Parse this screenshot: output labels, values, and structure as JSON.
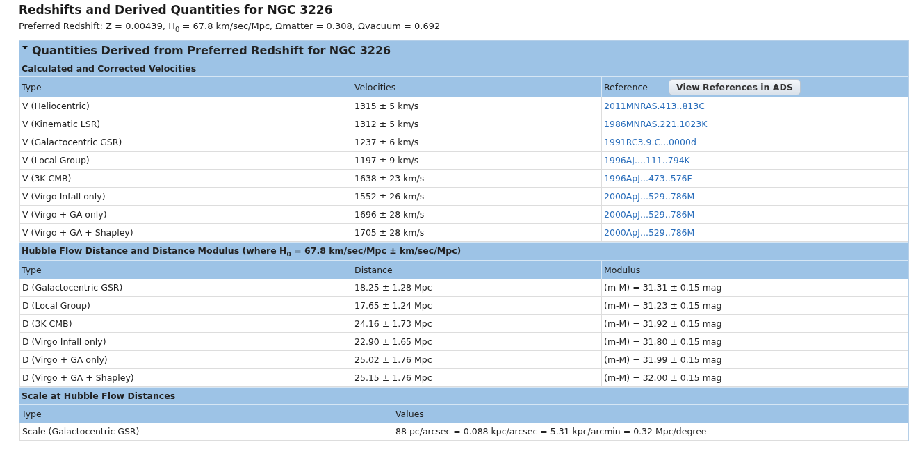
{
  "page_title": "Redshifts and Derived Quantities for NGC 3226",
  "preferred_redshift": "Preferred Redshift: Z = 0.00439, H$_{0}$ = 67.8 km/sec/Mpc, Ωmatter = 0.308, Ωvacuum = 0.692",
  "panel": {
    "title": "Quantities Derived from Preferred Redshift for NGC 3226",
    "expanded": true,
    "sections": [
      {
        "kind": "references",
        "title": "Calculated and Corrected Velocities",
        "columns": [
          "Type",
          "Velocities",
          "Reference"
        ],
        "button": "View References in ADS",
        "rows": [
          {
            "cells": [
              "V (Heliocentric)",
              "1315 ± 5 km/s",
              "2011MNRAS.413..813C"
            ]
          },
          {
            "cells": [
              "V (Kinematic LSR)",
              "1312 ± 5 km/s",
              "1986MNRAS.221.1023K"
            ]
          },
          {
            "cells": [
              "V (Galactocentric GSR)",
              "1237 ± 6 km/s",
              "1991RC3.9.C...0000d"
            ]
          },
          {
            "cells": [
              "V (Local Group)",
              "1197 ± 9 km/s",
              "1996AJ....111..794K"
            ]
          },
          {
            "cells": [
              "V (3K CMB)",
              "1638 ± 23 km/s",
              "1996ApJ...473..576F"
            ]
          },
          {
            "cells": [
              "V (Virgo Infall only)",
              "1552 ± 26 km/s",
              "2000ApJ...529..786M"
            ]
          },
          {
            "cells": [
              "V (Virgo + GA only)",
              "1696 ± 28 km/s",
              "2000ApJ...529..786M"
            ]
          },
          {
            "cells": [
              "V (Virgo + GA + Shapley)",
              "1705 ± 28 km/s",
              "2000ApJ...529..786M"
            ]
          }
        ]
      },
      {
        "kind": "distances",
        "title": "Hubble Flow Distance and Distance Modulus (where H$_{0}$ = 67.8 km/sec/Mpc ± km/sec/Mpc)",
        "columns": [
          "Type",
          "Distance",
          "Modulus"
        ],
        "rows": [
          {
            "cells": [
              "D (Galactocentric GSR)",
              "18.25 ± 1.28 Mpc",
              "(m-M) = 31.31 ± 0.15 mag"
            ]
          },
          {
            "cells": [
              "D (Local Group)",
              "17.65 ± 1.24 Mpc",
              "(m-M) = 31.23 ± 0.15 mag"
            ]
          },
          {
            "cells": [
              "D (3K CMB)",
              "24.16 ± 1.73 Mpc",
              "(m-M) = 31.92 ± 0.15 mag"
            ]
          },
          {
            "cells": [
              "D (Virgo Infall only)",
              "22.90 ± 1.65 Mpc",
              "(m-M) = 31.80 ± 0.15 mag"
            ]
          },
          {
            "cells": [
              "D (Virgo + GA only)",
              "25.02 ± 1.76 Mpc",
              "(m-M) = 31.99 ± 0.15 mag"
            ]
          },
          {
            "cells": [
              "D (Virgo + GA + Shapley)",
              "25.15 ± 1.76 Mpc",
              "(m-M) = 32.00 ± 0.15 mag"
            ]
          }
        ]
      },
      {
        "kind": "scale",
        "title": "Scale at Hubble Flow Distances",
        "columns": [
          "Type",
          "Values"
        ],
        "rows": [
          {
            "cells": [
              "Scale (Galactocentric GSR)",
              "88 pc/arcsec = 0.088 kpc/arcsec = 5.31 kpc/arcmin = 0.32 Mpc/degree"
            ]
          }
        ]
      }
    ]
  }
}
